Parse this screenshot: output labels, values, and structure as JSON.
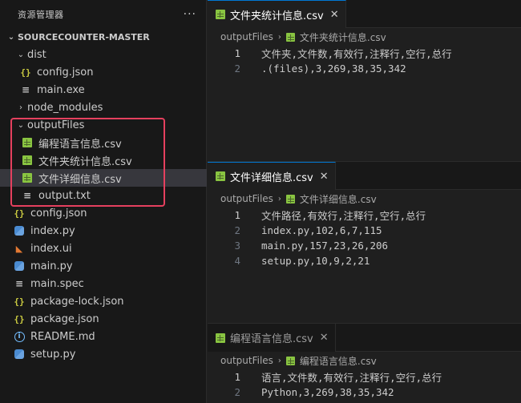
{
  "explorer": {
    "title": "资源管理器",
    "more": "···",
    "root": "SOURCECOUNTER-MASTER",
    "items": [
      {
        "label": "dist",
        "chevron": "⌄",
        "icon": "none"
      },
      {
        "label": "config.json",
        "icon": "json"
      },
      {
        "label": "main.exe",
        "icon": "lines"
      },
      {
        "label": "node_modules",
        "chevron": "›",
        "icon": "none"
      },
      {
        "label": "outputFiles",
        "chevron": "⌄",
        "icon": "none"
      },
      {
        "label": "编程语言信息.csv",
        "icon": "csv"
      },
      {
        "label": "文件夹统计信息.csv",
        "icon": "csv"
      },
      {
        "label": "文件详细信息.csv",
        "icon": "csv"
      },
      {
        "label": "output.txt",
        "icon": "lines"
      },
      {
        "label": "config.json",
        "icon": "json"
      },
      {
        "label": "index.py",
        "icon": "python"
      },
      {
        "label": "index.ui",
        "icon": "rss"
      },
      {
        "label": "main.py",
        "icon": "python"
      },
      {
        "label": "main.spec",
        "icon": "lines"
      },
      {
        "label": "package-lock.json",
        "icon": "json"
      },
      {
        "label": "package.json",
        "icon": "json"
      },
      {
        "label": "README.md",
        "icon": "info"
      },
      {
        "label": "setup.py",
        "icon": "python"
      }
    ]
  },
  "panes": [
    {
      "tab": "文件夹统计信息.csv",
      "breadcrumb_folder": "outputFiles",
      "breadcrumb_file": "文件夹统计信息.csv",
      "lines": [
        {
          "n": "1",
          "text": "文件夹,文件数,有效行,注释行,空行,总行"
        },
        {
          "n": "2",
          "text": ".(files),3,269,38,35,342"
        }
      ]
    },
    {
      "tab": "文件详细信息.csv",
      "breadcrumb_folder": "outputFiles",
      "breadcrumb_file": "文件详细信息.csv",
      "lines": [
        {
          "n": "1",
          "text": "文件路径,有效行,注释行,空行,总行"
        },
        {
          "n": "2",
          "text": "index.py,102,6,7,115"
        },
        {
          "n": "3",
          "text": "main.py,157,23,26,206"
        },
        {
          "n": "4",
          "text": "setup.py,10,9,2,21"
        }
      ]
    },
    {
      "tab": "编程语言信息.csv",
      "breadcrumb_folder": "outputFiles",
      "breadcrumb_file": "编程语言信息.csv",
      "lines": [
        {
          "n": "1",
          "text": "语言,文件数,有效行,注释行,空行,总行"
        },
        {
          "n": "2",
          "text": "Python,3,269,38,35,342"
        }
      ]
    }
  ],
  "icons": {
    "close": "close-icon",
    "chevron": "chevron-right-icon"
  },
  "colors": {
    "highlight": "#e5405e",
    "csv": "#89c441",
    "accent": "#0078d4"
  }
}
